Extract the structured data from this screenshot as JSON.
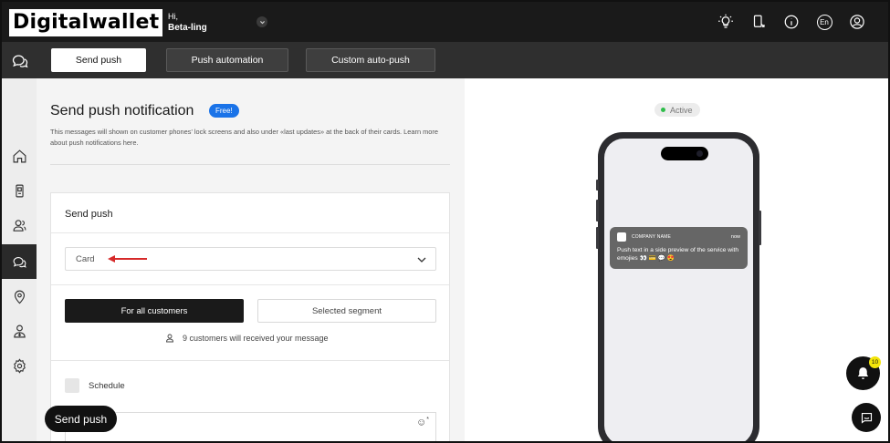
{
  "header": {
    "logo_text": "Digitalwallet",
    "greeting": "Hi,",
    "username": "Beta-ling",
    "lang": "En"
  },
  "tabs": [
    {
      "label": "Send push",
      "active": true
    },
    {
      "label": "Push automation",
      "active": false
    },
    {
      "label": "Custom auto-push",
      "active": false
    }
  ],
  "sidebar": {
    "items": [
      "home-icon",
      "card-icon",
      "customers-icon",
      "chat-icon",
      "location-icon",
      "user-upload-icon",
      "gear-icon"
    ],
    "active_index": 3
  },
  "main": {
    "title": "Send push notification",
    "badge": "Free!",
    "description": "This messages will shown on customer phones' lock screens and also under «last updates» at the back of their cards. Learn more about push notifications here.",
    "form": {
      "section_title": "Send push",
      "card_select_value": "Card",
      "all_customers_label": "For all customers",
      "segment_label": "Selected segment",
      "recipients_info": "9 customers will received your message",
      "schedule_label": "Schedule",
      "emoji_required": "*"
    },
    "send_button": "Send push"
  },
  "preview": {
    "status": "Active",
    "notification": {
      "company": "COMPANY NAME",
      "time": "now",
      "text": "Push text in a side preview of the service with emojies 👀 💳 💬 😍"
    }
  },
  "floating": {
    "notification_count": "10"
  },
  "colors": {
    "topbar": "#1a1a1a",
    "subbar": "#2f2f2f",
    "accent_blue": "#1a73e8",
    "active_green": "#2ebd4a",
    "badge_yellow": "#f4e50a",
    "arrow_red": "#d62a2a"
  }
}
